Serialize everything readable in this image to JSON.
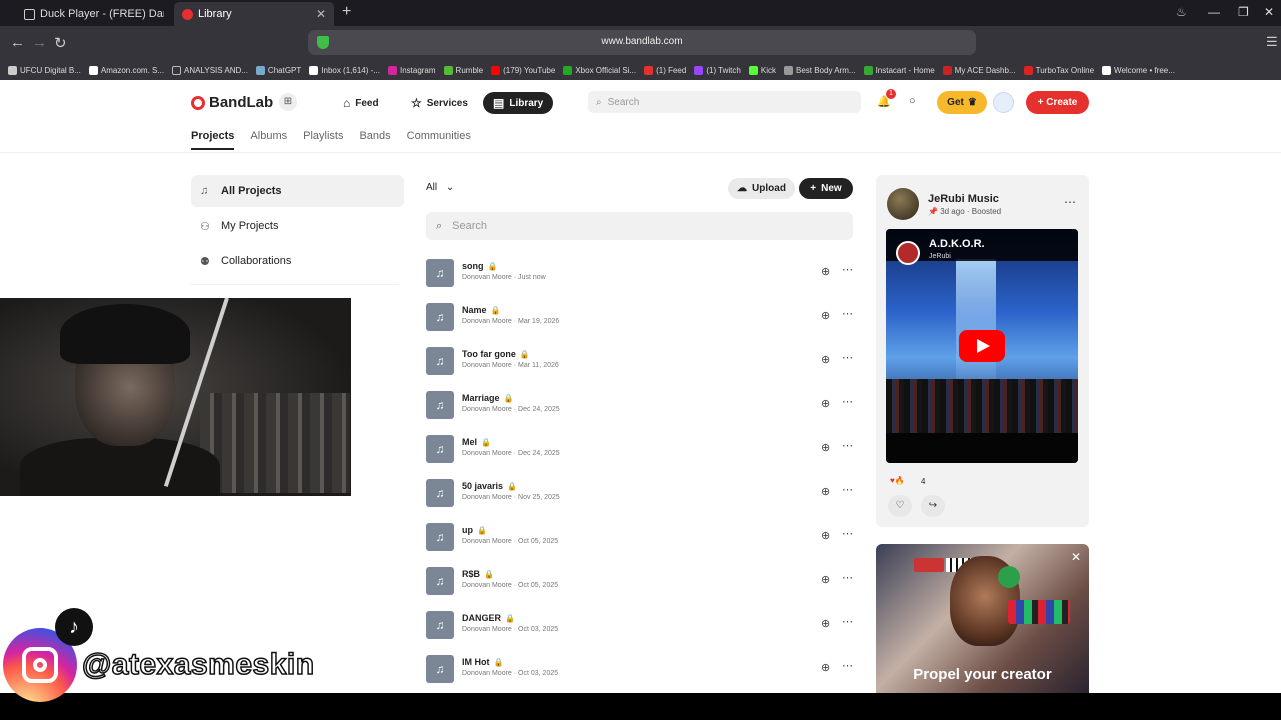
{
  "browser": {
    "tabs": [
      {
        "title": "Duck Player - (FREE) Daniel Caesar",
        "active": false
      },
      {
        "title": "Library",
        "active": true
      }
    ],
    "url": "www.bandlab.com",
    "bookmarks": [
      "UFCU Digital B...",
      "Amazon.com. S...",
      "ANALYSIS AND...",
      "ChatGPT",
      "Inbox (1,614) -...",
      "Instagram",
      "Rumble",
      "(179) YouTube",
      "Xbox Official Si...",
      "(1) Feed",
      "(1) Twitch",
      "Kick",
      "Best Body Arm...",
      "Instacart - Home",
      "My ACE Dashb...",
      "TurboTax Online",
      "Welcome • free..."
    ]
  },
  "header": {
    "brand": "BandLab",
    "nav": {
      "feed": "Feed",
      "services": "Services",
      "library": "Library"
    },
    "search_placeholder": "Search",
    "notification_count": "1",
    "get_label": "Get",
    "create_label": "+ Create"
  },
  "subnav": {
    "projects": "Projects",
    "albums": "Albums",
    "playlists": "Playlists",
    "bands": "Bands",
    "communities": "Communities"
  },
  "sidebar": {
    "all_projects": "All Projects",
    "my_projects": "My Projects",
    "collaborations": "Collaborations"
  },
  "main": {
    "filter": "All",
    "upload_label": "Upload",
    "new_label": "New",
    "search_placeholder": "Search",
    "projects": [
      {
        "name": "song",
        "author": "Donovan Moore",
        "date": "Just now"
      },
      {
        "name": "Name",
        "author": "Donovan Moore",
        "date": "Mar 19, 2026"
      },
      {
        "name": "Too far gone",
        "author": "Donovan Moore",
        "date": "Mar 11, 2026"
      },
      {
        "name": "Marriage",
        "author": "Donovan Moore",
        "date": "Dec 24, 2025"
      },
      {
        "name": "Mel",
        "author": "Donovan Moore",
        "date": "Dec 24, 2025"
      },
      {
        "name": "50 javaris",
        "author": "Donovan Moore",
        "date": "Nov 25, 2025"
      },
      {
        "name": "up",
        "author": "Donovan Moore",
        "date": "Oct 05, 2025"
      },
      {
        "name": "R$B",
        "author": "Donovan Moore",
        "date": "Oct 05, 2025"
      },
      {
        "name": "DANGER",
        "author": "Donovan Moore",
        "date": "Oct 03, 2025"
      },
      {
        "name": "IM Hot",
        "author": "Donovan Moore",
        "date": "Oct 03, 2025"
      }
    ]
  },
  "post_card": {
    "author": "JeRubi Music",
    "meta": "3d ago · Boosted",
    "video_title": "A.D.K.O.R.",
    "video_channel": "JeRubi",
    "reaction_count": "4"
  },
  "promo": {
    "text": "Propel your creator"
  },
  "overlay": {
    "handle": "@atexasmeskin"
  },
  "colors": {
    "brand_red": "#e5302e",
    "get_yellow": "#f7b92b"
  }
}
